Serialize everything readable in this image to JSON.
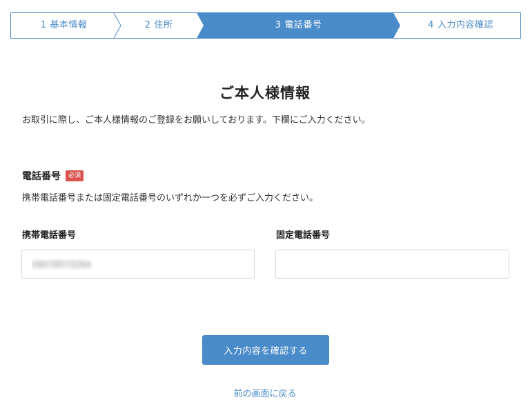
{
  "steps": [
    {
      "number": "1",
      "label": "基本情報",
      "state": "done"
    },
    {
      "number": "2",
      "label": "住所",
      "state": "done"
    },
    {
      "number": "3",
      "label": "電話番号",
      "state": "active"
    },
    {
      "number": "4",
      "label": "入力内容確認",
      "state": "pending"
    }
  ],
  "colors": {
    "accent": "#4a8bc9",
    "required_badge": "#d9534f",
    "border": "#d6d6d6"
  },
  "page": {
    "title": "ご本人様情報",
    "intro": "お取引に際し、ご本人様情報のご登録をお願いしております。下欄にご入力ください。"
  },
  "phone_section": {
    "label": "電話番号",
    "required_badge": "必須",
    "note": "携帯電話番号または固定電話番号のいずれか一つを必ずご入力ください。"
  },
  "fields": {
    "mobile": {
      "label": "携帯電話番号",
      "value": "09078573284"
    },
    "landline": {
      "label": "固定電話番号",
      "value": ""
    }
  },
  "actions": {
    "submit_label": "入力内容を確認する",
    "back_label": "前の画面に戻る"
  }
}
